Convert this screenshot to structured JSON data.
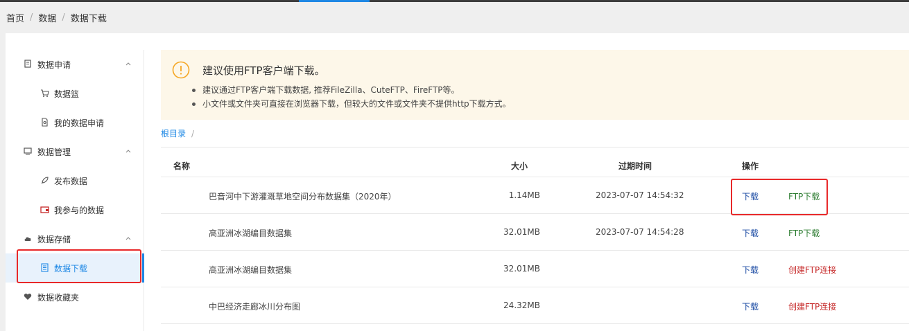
{
  "breadcrumb": [
    "首页",
    "数据",
    "数据下载"
  ],
  "sidebar": {
    "groups": [
      {
        "label": "数据申请",
        "icon": "document-icon",
        "items": [
          {
            "label": "数据篮",
            "icon": "cart-icon"
          },
          {
            "label": "我的数据申请",
            "icon": "file-icon"
          }
        ]
      },
      {
        "label": "数据管理",
        "icon": "monitor-icon",
        "items": [
          {
            "label": "发布数据",
            "icon": "rocket-icon"
          },
          {
            "label": "我参与的数据",
            "icon": "wallet-icon"
          }
        ]
      },
      {
        "label": "数据存储",
        "icon": "cloud-icon",
        "items": [
          {
            "label": "数据下载",
            "icon": "list-icon",
            "active": true
          }
        ]
      },
      {
        "label": "数据收藏夹",
        "icon": "heart-icon",
        "items": []
      }
    ]
  },
  "notice": {
    "title": "建议使用FTP客户端下载。",
    "items": [
      "建议通过FTP客户端下载数据, 推荐FileZilla、CuteFTP、FireFTP等。",
      "小文件或文件夹可直接在浏览器下载，但较大的文件或文件夹不提供http下载方式。"
    ]
  },
  "directory": {
    "root": "根目录",
    "separator": "/"
  },
  "table": {
    "headers": {
      "name": "名称",
      "size": "大小",
      "expire": "过期时间",
      "action": "操作"
    },
    "rows": [
      {
        "name": "巴音河中下游灌溉草地空间分布数据集（2020年）",
        "size": "1.14MB",
        "expire": "2023-07-07 14:54:32",
        "download": "下载",
        "ftp": "FTP下载",
        "ftp_type": "ftp"
      },
      {
        "name": "高亚洲冰湖编目数据集",
        "size": "32.01MB",
        "expire": "2023-07-07 14:54:28",
        "download": "下载",
        "ftp": "FTP下载",
        "ftp_type": "ftp"
      },
      {
        "name": "高亚洲冰湖编目数据集",
        "size": "32.01MB",
        "expire": "",
        "download": "下载",
        "ftp": "创建FTP连接",
        "ftp_type": "create"
      },
      {
        "name": "中巴经济走廊冰川分布图",
        "size": "24.32MB",
        "expire": "",
        "download": "下载",
        "ftp": "创建FTP连接",
        "ftp_type": "create"
      }
    ]
  },
  "colors": {
    "accent": "#1e88e5",
    "highlight": "#e8292a",
    "ftp": "#2e7d32",
    "create_ftp": "#c62828",
    "download": "#1a4aa3",
    "notice_bg": "#fdf7e9"
  }
}
